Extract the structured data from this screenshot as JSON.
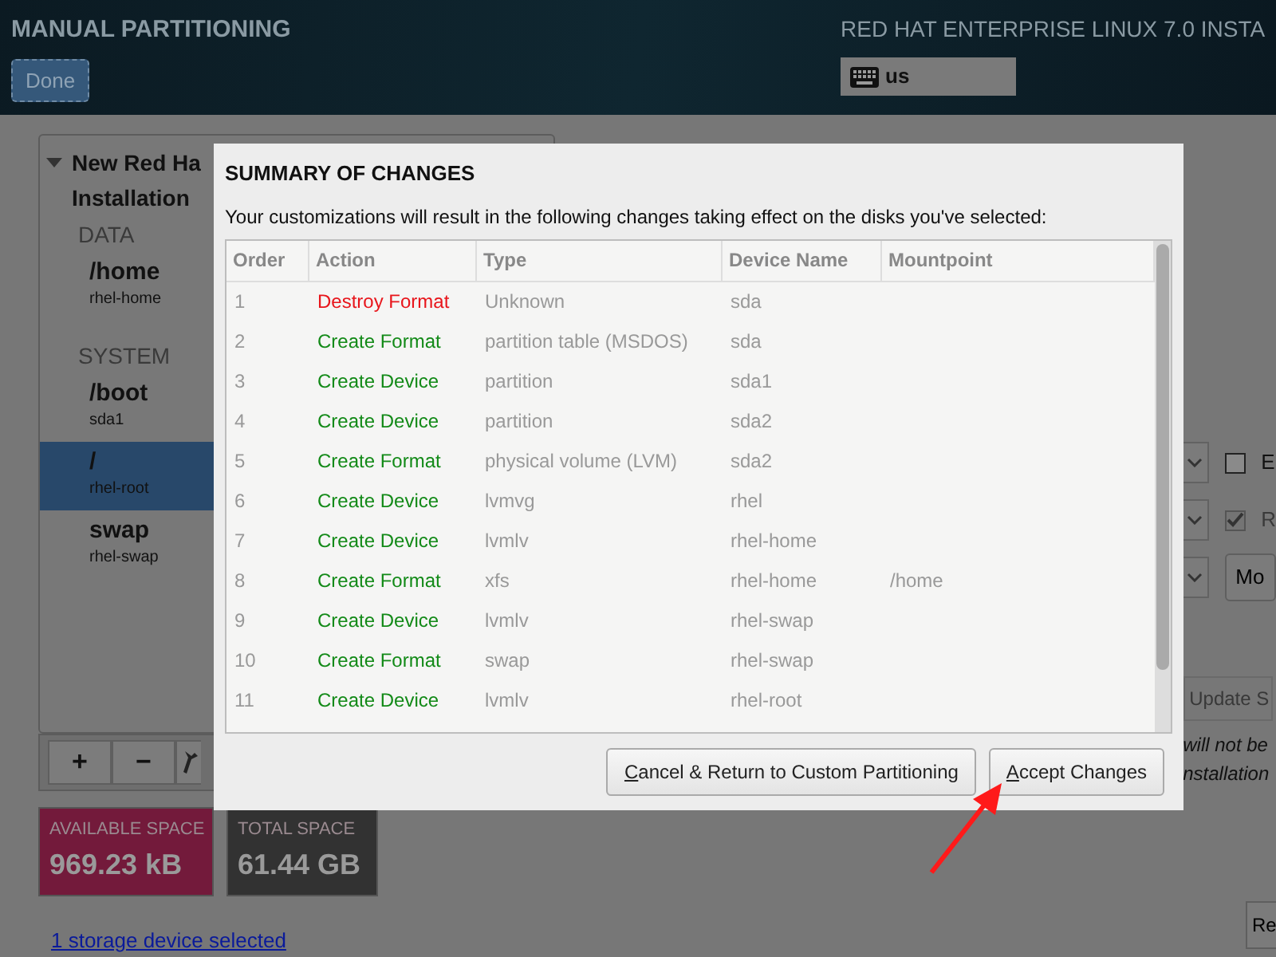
{
  "header": {
    "title": "MANUAL PARTITIONING",
    "done_button": "Done",
    "product_title": "RED HAT ENTERPRISE LINUX 7.0 INSTA",
    "keyboard_layout": "us"
  },
  "partitions_panel": {
    "heading_lines": [
      "New Red Ha",
      "Installation"
    ],
    "groups": [
      {
        "label": "DATA",
        "items": [
          {
            "mount": "/home",
            "device": "rhel-home",
            "selected": false
          }
        ]
      },
      {
        "label": "SYSTEM",
        "items": [
          {
            "mount": "/boot",
            "device": "sda1",
            "selected": false
          },
          {
            "mount": "/",
            "device": "rhel-root",
            "selected": true
          },
          {
            "mount": "swap",
            "device": "rhel-swap",
            "selected": false
          }
        ]
      }
    ],
    "toolbar": [
      "+",
      "−"
    ]
  },
  "space": [
    {
      "label": "AVAILABLE SPACE",
      "value": "969.23 kB",
      "kind": "available"
    },
    {
      "label": "TOTAL SPACE",
      "value": "61.44 GB",
      "kind": "total"
    }
  ],
  "storage_link": "1 storage device selected",
  "right_panel": {
    "rows": [
      {
        "kind": "checkbox",
        "label": "E",
        "checked": false,
        "disabled": false
      },
      {
        "kind": "checkbox",
        "label": "R",
        "checked": true,
        "disabled": true
      },
      {
        "kind": "button",
        "label": "Mo"
      }
    ],
    "update_button": "Update S",
    "note_lines": [
      "will not be",
      "nstallation"
    ],
    "reset_button": "Re"
  },
  "dialog": {
    "title": "SUMMARY OF CHANGES",
    "message": "Your customizations will result in the following changes taking effect on the disks you've selected:",
    "columns": [
      "Order",
      "Action",
      "Type",
      "Device Name",
      "Mountpoint"
    ],
    "rows": [
      {
        "order": "1",
        "action": "Destroy Format",
        "kind": "destroy",
        "type": "Unknown",
        "device": "sda"
      },
      {
        "order": "2",
        "action": "Create Format",
        "kind": "create",
        "type": "partition table (MSDOS)",
        "device": "sda"
      },
      {
        "order": "3",
        "action": "Create Device",
        "kind": "create",
        "type": "partition",
        "device": "sda1"
      },
      {
        "order": "4",
        "action": "Create Device",
        "kind": "create",
        "type": "partition",
        "device": "sda2"
      },
      {
        "order": "5",
        "action": "Create Format",
        "kind": "create",
        "type": "physical volume (LVM)",
        "device": "sda2"
      },
      {
        "order": "6",
        "action": "Create Device",
        "kind": "create",
        "type": "lvmvg",
        "device": "rhel"
      },
      {
        "order": "7",
        "action": "Create Device",
        "kind": "create",
        "type": "lvmlv",
        "device": "rhel-home"
      },
      {
        "order": "8",
        "action": "Create Format",
        "kind": "create",
        "type": "xfs",
        "device": "rhel-home",
        "mountpoint": "/home"
      },
      {
        "order": "9",
        "action": "Create Device",
        "kind": "create",
        "type": "lvmlv",
        "device": "rhel-swap"
      },
      {
        "order": "10",
        "action": "Create Format",
        "kind": "create",
        "type": "swap",
        "device": "rhel-swap"
      },
      {
        "order": "11",
        "action": "Create Device",
        "kind": "create",
        "type": "lvmlv",
        "device": "rhel-root"
      }
    ],
    "buttons": [
      {
        "label": "Cancel & Return to Custom Partitioning",
        "mnemonic_underlined": true
      },
      {
        "label": "Accept Changes",
        "mnemonic_underlined": true
      }
    ]
  }
}
